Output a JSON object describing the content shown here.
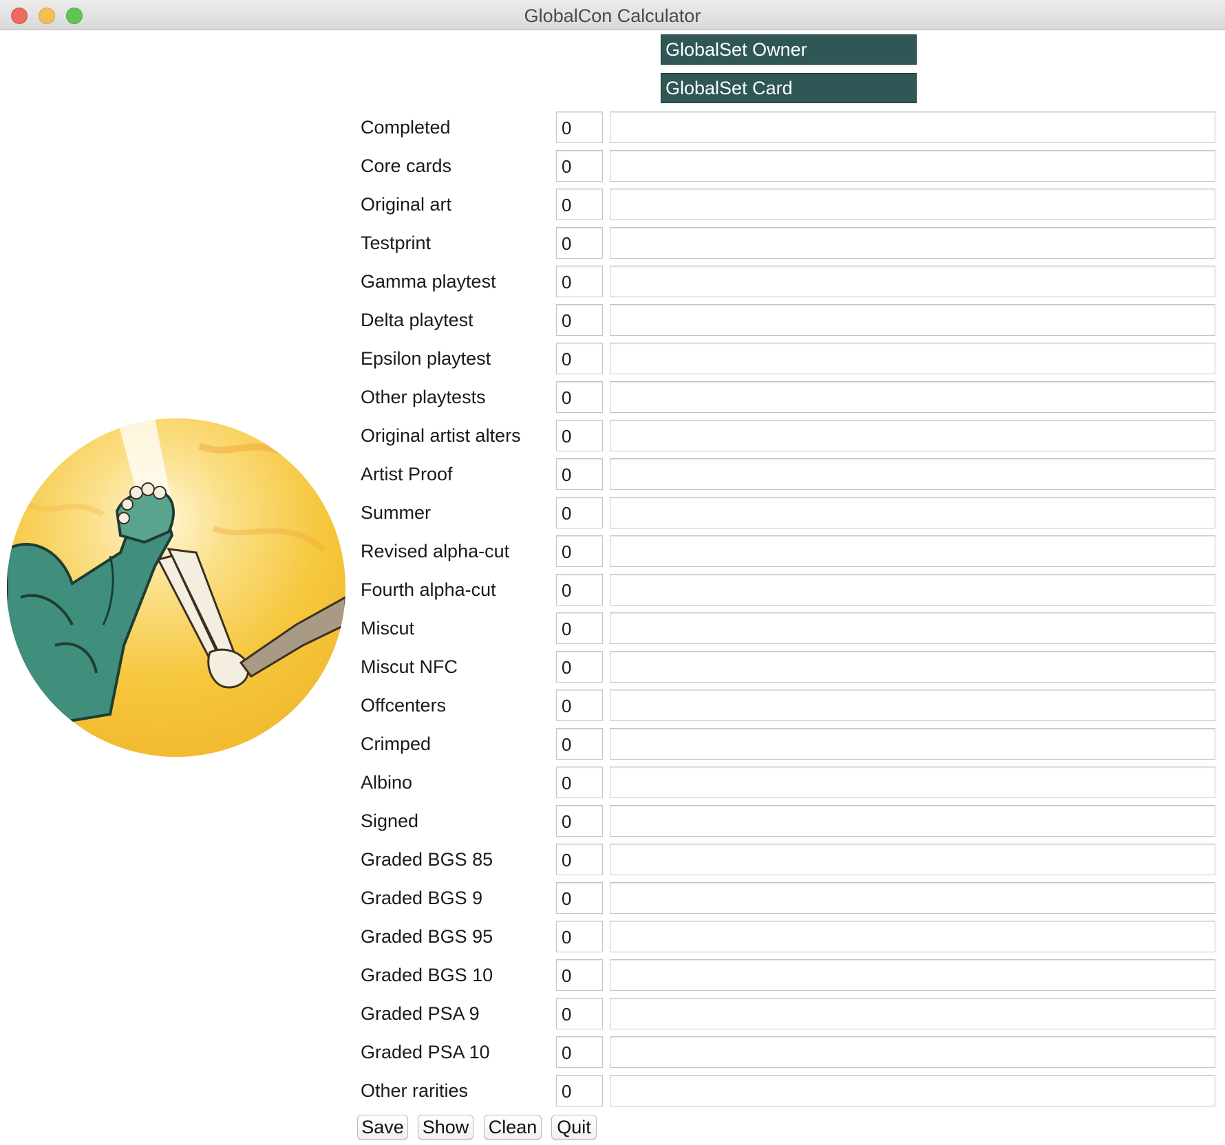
{
  "window": {
    "title": "GlobalCon Calculator"
  },
  "header": {
    "owner_label": "GlobalSet Owner",
    "card_label": "GlobalSet Card"
  },
  "rows": [
    {
      "label": "Completed",
      "count": "0",
      "note": ""
    },
    {
      "label": "Core cards",
      "count": "0",
      "note": ""
    },
    {
      "label": "Original art",
      "count": "0",
      "note": ""
    },
    {
      "label": "Testprint",
      "count": "0",
      "note": ""
    },
    {
      "label": "Gamma playtest",
      "count": "0",
      "note": ""
    },
    {
      "label": "Delta playtest",
      "count": "0",
      "note": ""
    },
    {
      "label": "Epsilon playtest",
      "count": "0",
      "note": ""
    },
    {
      "label": "Other playtests",
      "count": "0",
      "note": ""
    },
    {
      "label": "Original artist alters",
      "count": "0",
      "note": ""
    },
    {
      "label": "Artist Proof",
      "count": "0",
      "note": ""
    },
    {
      "label": "Summer",
      "count": "0",
      "note": ""
    },
    {
      "label": "Revised alpha-cut",
      "count": "0",
      "note": ""
    },
    {
      "label": "Fourth alpha-cut",
      "count": "0",
      "note": ""
    },
    {
      "label": "Miscut",
      "count": "0",
      "note": ""
    },
    {
      "label": "Miscut NFC",
      "count": "0",
      "note": ""
    },
    {
      "label": "Offcenters",
      "count": "0",
      "note": ""
    },
    {
      "label": "Crimped",
      "count": "0",
      "note": ""
    },
    {
      "label": "Albino",
      "count": "0",
      "note": ""
    },
    {
      "label": "Signed",
      "count": "0",
      "note": ""
    },
    {
      "label": "Graded BGS 85",
      "count": "0",
      "note": ""
    },
    {
      "label": "Graded BGS 9",
      "count": "0",
      "note": ""
    },
    {
      "label": "Graded BGS 95",
      "count": "0",
      "note": ""
    },
    {
      "label": "Graded BGS 10",
      "count": "0",
      "note": ""
    },
    {
      "label": "Graded PSA 9",
      "count": "0",
      "note": ""
    },
    {
      "label": "Graded PSA 10",
      "count": "0",
      "note": ""
    },
    {
      "label": "Other rarities",
      "count": "0",
      "note": ""
    }
  ],
  "buttons": {
    "save": "Save",
    "show": "Show",
    "clean": "Clean",
    "quit": "Quit"
  },
  "colors": {
    "header_box": "#2f5756",
    "illustration_background": "#f5c63a",
    "green_arm": "#3f8f7c",
    "skeleton_arm": "#f3eee0"
  },
  "icons": [
    "close-icon",
    "minimize-icon",
    "maximize-icon"
  ]
}
